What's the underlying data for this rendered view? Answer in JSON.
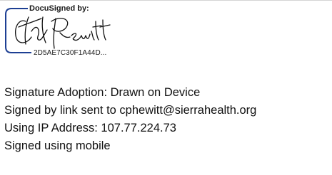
{
  "signature_block": {
    "header": "DocuSigned by:",
    "envelope_id": "2D5AE7C30F1A44D...",
    "signature_drawing": "handwritten-signature"
  },
  "details": [
    "Signature Adoption: Drawn on Device",
    "Signed by link sent to cphewitt@sierrahealth.org",
    "Using IP Address: 107.77.224.73",
    "Signed using mobile"
  ]
}
